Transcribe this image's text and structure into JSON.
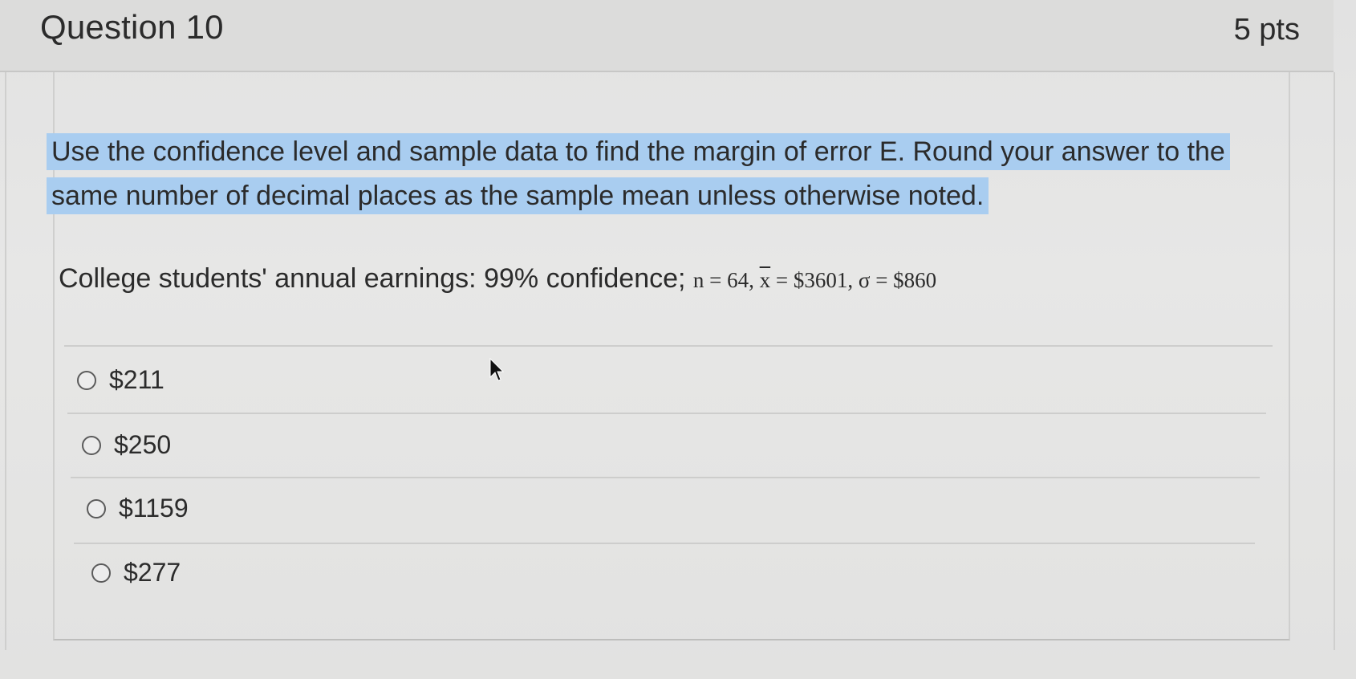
{
  "question": {
    "title": "Question 10",
    "points": "5 pts"
  },
  "prompt": {
    "line1": "Use the confidence level and sample data to find the margin of error E. Round your answer to the",
    "line2": "same number of decimal places as the sample mean unless otherwise noted."
  },
  "problem": {
    "lead": "College students' annual earnings: 99% confidence; ",
    "n": "n = 64, ",
    "xbar_symbol": "x",
    "xbar_value": " = $3601, ",
    "sigma": "σ = $860"
  },
  "answers": [
    {
      "label": "$211"
    },
    {
      "label": "$250"
    },
    {
      "label": "$1159"
    },
    {
      "label": "$277"
    }
  ],
  "colors": {
    "highlight": "#a9cdf0",
    "background": "#e4e4e3",
    "text": "#2b2b2b"
  },
  "icons": {
    "cursor": "mouse-pointer-icon",
    "radio": "radio-button-icon"
  }
}
